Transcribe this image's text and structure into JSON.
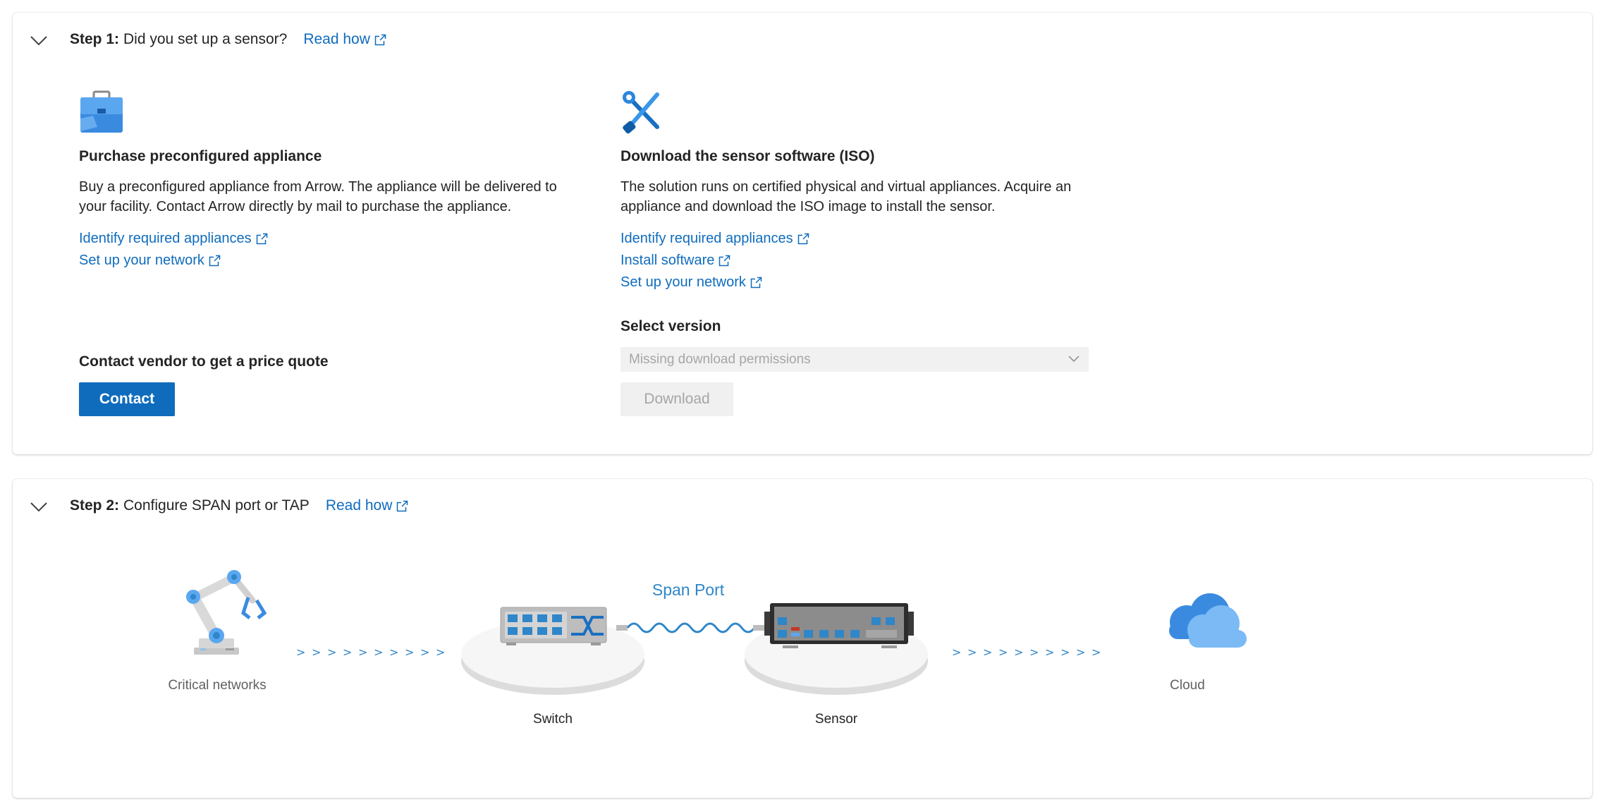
{
  "step1": {
    "step_label": "Step 1:",
    "title": "Did you set up a sensor?",
    "read_how": "Read how",
    "appliance": {
      "icon": "briefcase-icon",
      "heading": "Purchase preconfigured appliance",
      "description": "Buy a preconfigured appliance from Arrow. The appliance will be delivered to your facility. Contact Arrow directly by mail to purchase the appliance.",
      "links": [
        "Identify required appliances",
        "Set up your network"
      ],
      "vendor_heading": "Contact vendor to get a price quote",
      "contact_button": "Contact"
    },
    "software": {
      "icon": "wrench-screwdriver-icon",
      "heading": "Download the sensor software (ISO)",
      "description": "The solution runs on certified physical and virtual appliances. Acquire an appliance and download the ISO image to install the sensor.",
      "links": [
        "Identify required appliances",
        "Install software",
        "Set up your network"
      ],
      "select_label": "Select version",
      "select_value": "Missing download permissions",
      "download_button": "Download"
    }
  },
  "step2": {
    "step_label": "Step 2:",
    "title": "Configure SPAN port or TAP",
    "read_how": "Read how",
    "diagram": {
      "nodes": [
        "Critical networks",
        "Switch",
        "Sensor",
        "Cloud"
      ],
      "span_label": "Span Port"
    }
  },
  "colors": {
    "link": "#0f6cbd",
    "primary_button": "#0f6cbd",
    "diagram_accent": "#2f86c8"
  }
}
